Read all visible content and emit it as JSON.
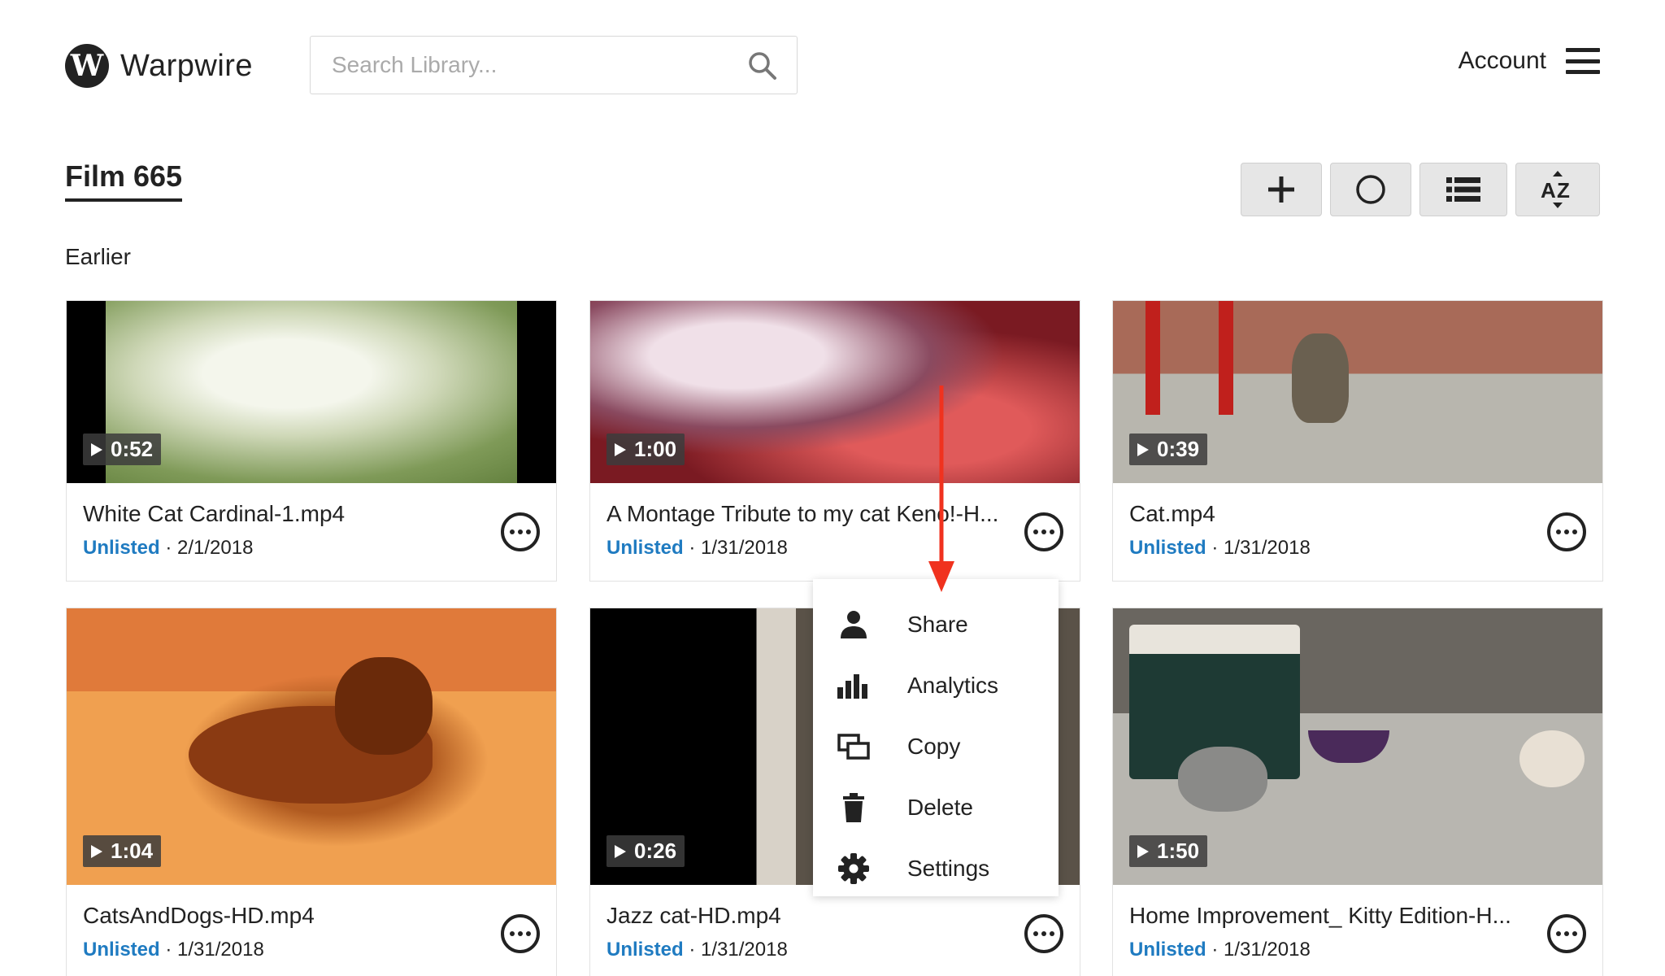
{
  "header": {
    "logo_letter": "W",
    "app_name": "Warpwire",
    "search_placeholder": "Search Library...",
    "account_label": "Account"
  },
  "page": {
    "title": "Film 665",
    "section_label": "Earlier"
  },
  "toolbar": {
    "icons": [
      "plus-icon",
      "circle-icon",
      "list-view-icon",
      "sort-az-icon"
    ]
  },
  "videos": [
    {
      "title": "White Cat Cardinal-1.mp4",
      "status": "Unlisted",
      "date": "2/1/2018",
      "duration": "0:52"
    },
    {
      "title": "A Montage Tribute to my cat Keno!-H...",
      "status": "Unlisted",
      "date": "1/31/2018",
      "duration": "1:00"
    },
    {
      "title": "Cat.mp4",
      "status": "Unlisted",
      "date": "1/31/2018",
      "duration": "0:39"
    },
    {
      "title": "CatsAndDogs-HD.mp4",
      "status": "Unlisted",
      "date": "1/31/2018",
      "duration": "1:04"
    },
    {
      "title": "Jazz cat-HD.mp4",
      "status": "Unlisted",
      "date": "1/31/2018",
      "duration": "0:26"
    },
    {
      "title": "Home Improvement_ Kitty Edition-H...",
      "status": "Unlisted",
      "date": "1/31/2018",
      "duration": "1:50"
    }
  ],
  "context_menu": {
    "items": [
      {
        "label": "Share",
        "icon": "person-icon"
      },
      {
        "label": "Analytics",
        "icon": "bar-chart-icon"
      },
      {
        "label": "Copy",
        "icon": "copy-icon"
      },
      {
        "label": "Delete",
        "icon": "trash-icon"
      },
      {
        "label": "Settings",
        "icon": "gear-icon"
      }
    ]
  },
  "colors": {
    "status_link": "#1f7bc1",
    "annotation_arrow": "#f0321e",
    "toolbar_button_bg": "#e6e6e6"
  }
}
